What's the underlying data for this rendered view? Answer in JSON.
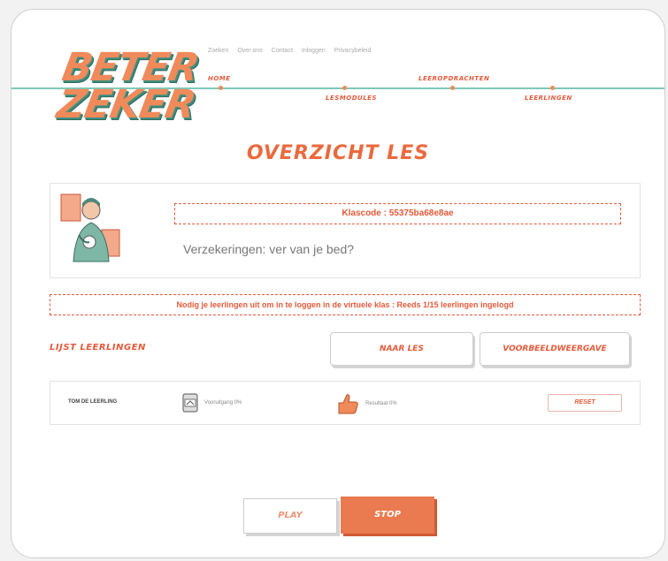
{
  "logo": {
    "line1": "BETER",
    "line2": "ZEKER"
  },
  "topnav": [
    "Zoeken",
    "Over ons",
    "Contact",
    "Inloggen",
    "Privacybeleid"
  ],
  "mainnav": {
    "home": "HOME",
    "lesmodules": "LESMODULES",
    "leeropdrachten": "LEEROPDRACHTEN",
    "leerlingen": "LEERLINGEN"
  },
  "page_title": "OVERZICHT LES",
  "lesson": {
    "klascode": "Klascode : 55375ba68e8ae",
    "name": "Verzekeringen: ver van je bed?"
  },
  "invite_text": "Nodig je leerlingen uit om in te loggen in de virtuele klas : Reeds 1/15 leerlingen ingelogd",
  "list": {
    "title": "LIJST LEERLINGEN",
    "naar_les": "NAAR LES",
    "voorbeeld": "VOORBEELDWEERGAVE"
  },
  "student": {
    "name": "TOM DE LEERLING",
    "progress": "Vooruitgang 0%",
    "result": "Resultaat 0%",
    "reset": "RESET"
  },
  "controls": {
    "play": "PLAY",
    "stop": "STOP"
  },
  "colors": {
    "accent": "#e45a3a",
    "orange": "#ea7a4f",
    "teal": "#7ec9b8"
  }
}
